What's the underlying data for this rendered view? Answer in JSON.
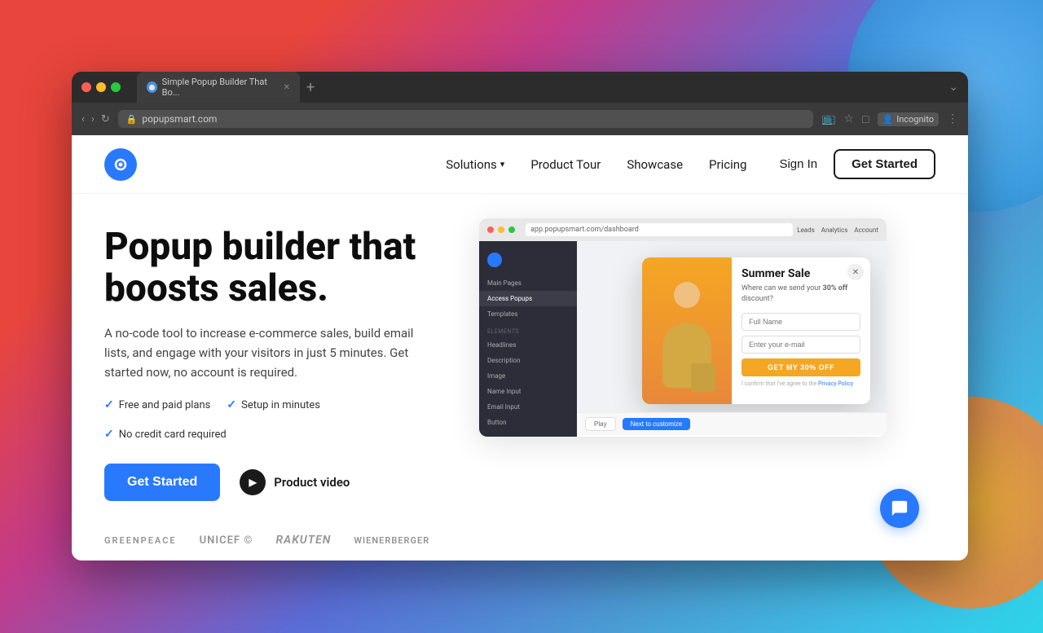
{
  "os": {
    "background": "macOS gradient"
  },
  "browser": {
    "tab": {
      "title": "Simple Popup Builder That Bo...",
      "favicon_alt": "popupsmart favicon"
    },
    "address": {
      "url": "popupsmart.com",
      "protocol_icon": "lock"
    },
    "controls": {
      "back": "‹",
      "forward": "›",
      "refresh": "↻",
      "new_tab": "+"
    },
    "profile": {
      "label": "Incognito"
    }
  },
  "navbar": {
    "logo_alt": "Popupsmart logo",
    "links": [
      {
        "label": "Solutions",
        "has_dropdown": true
      },
      {
        "label": "Product Tour",
        "has_dropdown": false
      },
      {
        "label": "Showcase",
        "has_dropdown": false
      },
      {
        "label": "Pricing",
        "has_dropdown": false
      }
    ],
    "sign_in_label": "Sign In",
    "get_started_label": "Get Started"
  },
  "hero": {
    "headline": "Popup builder that boosts sales.",
    "subtext": "A no-code tool to increase e-commerce sales, build email lists, and engage with your visitors in just 5 minutes. Get started now, no account is required.",
    "features": [
      {
        "label": "Free and paid plans"
      },
      {
        "label": "Setup in minutes"
      },
      {
        "label": "No credit card required"
      }
    ],
    "cta_primary": "Get Started",
    "cta_video": "Product video"
  },
  "brands": [
    {
      "label": "GREENPEACE"
    },
    {
      "label": "unicef ©"
    },
    {
      "label": "Rakuten"
    },
    {
      "label": "wienerberger"
    }
  ],
  "demo": {
    "url": "app.popupsmart.com/dashboard",
    "topbar_items": [
      "Leads",
      "Analytics",
      "Account"
    ],
    "sidebar_items": [
      "Main Pages",
      "Access Popups",
      "Templates",
      "Headlines",
      "Description",
      "Image",
      "Name Input",
      "Email Input",
      "Button"
    ],
    "popup": {
      "title": "Summer Sale",
      "desc_before": "Where can we send your ",
      "discount": "30% off",
      "desc_after": " discount?",
      "input1_placeholder": "Full Name",
      "input2_placeholder": "Enter your e-mail",
      "cta_label": "GET MY 30% OFF",
      "legal_text": "I confirm that I've agree to the",
      "privacy_label": "Privacy Policy"
    },
    "bottom_btns": [
      "Play",
      "Next to customize"
    ]
  },
  "chat_widget": {
    "icon": "💬"
  }
}
